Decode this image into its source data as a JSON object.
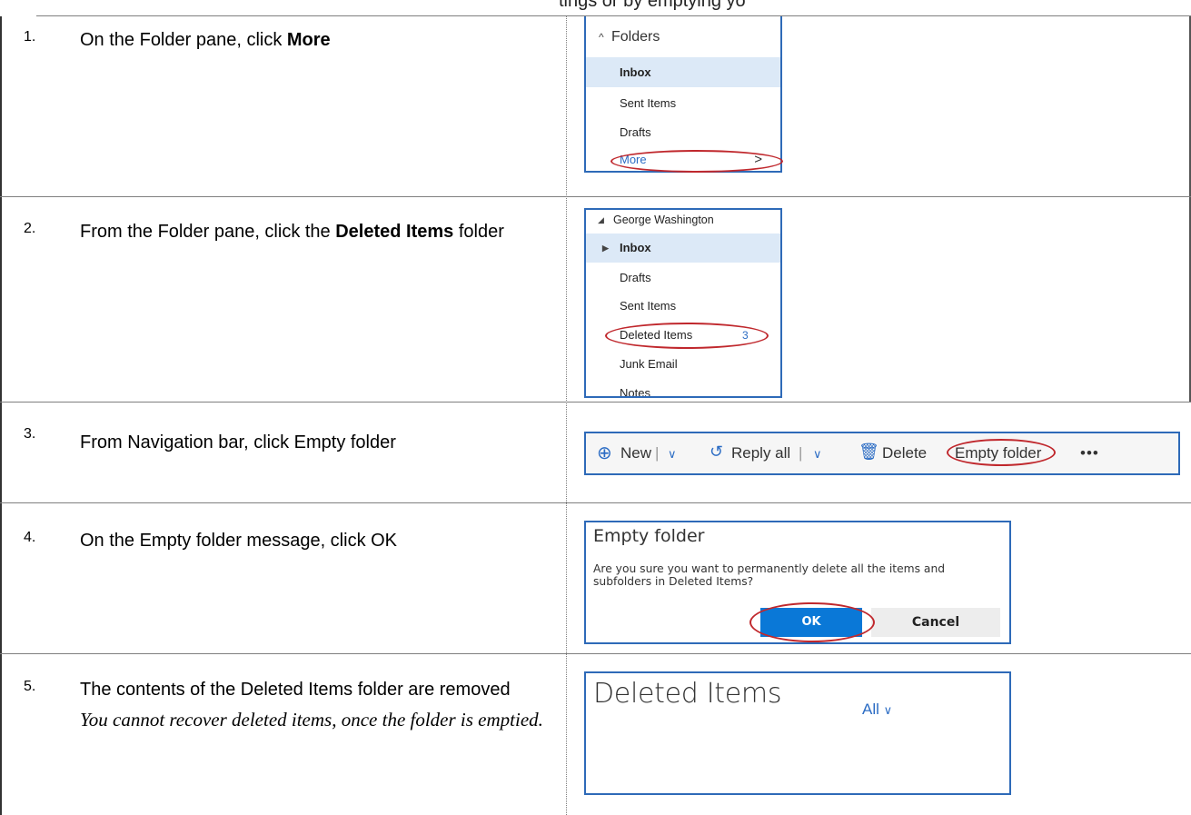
{
  "header": {
    "partial_text": "tings or by emptying yo"
  },
  "steps": [
    {
      "number": "1.",
      "text_plain": "On the Folder pane, click ",
      "text_bold": "More"
    },
    {
      "number": "2.",
      "text_plain": "From the Folder pane, click the ",
      "text_bold": "Deleted Items",
      "text_tail": " folder"
    },
    {
      "number": "3.",
      "text_plain": "From Navigation bar, click Empty folder"
    },
    {
      "number": "4.",
      "text_plain": "On the Empty folder message, click OK"
    },
    {
      "number": "5.",
      "text_plain": "The contents of the Deleted Items folder are removed",
      "note": "You cannot recover deleted items, once the folder is emptied."
    }
  ],
  "panel1": {
    "header": "Folders",
    "items": [
      "Inbox",
      "Sent Items",
      "Drafts",
      "More"
    ],
    "selected": "Inbox"
  },
  "panel2": {
    "account": "George Washington",
    "items": [
      "Inbox",
      "Drafts",
      "Sent Items",
      "Deleted Items",
      "Junk Email",
      "Notes"
    ],
    "deleted_count": "3"
  },
  "panel3": {
    "new_label": "New",
    "reply_all_label": "Reply all",
    "delete_label": "Delete",
    "empty_folder_label": "Empty folder",
    "more_label": "•••"
  },
  "panel4": {
    "title": "Empty folder",
    "message": "Are you sure you want to permanently delete all the items and subfolders in Deleted Items?",
    "ok_label": "OK",
    "cancel_label": "Cancel"
  },
  "panel5": {
    "title": "Deleted Items",
    "filter_label": "All"
  },
  "colors": {
    "accent": "#2b6cc4",
    "highlight": "#c0282d",
    "selected_bg": "#dce9f7",
    "ok_bg": "#0a78d7"
  }
}
